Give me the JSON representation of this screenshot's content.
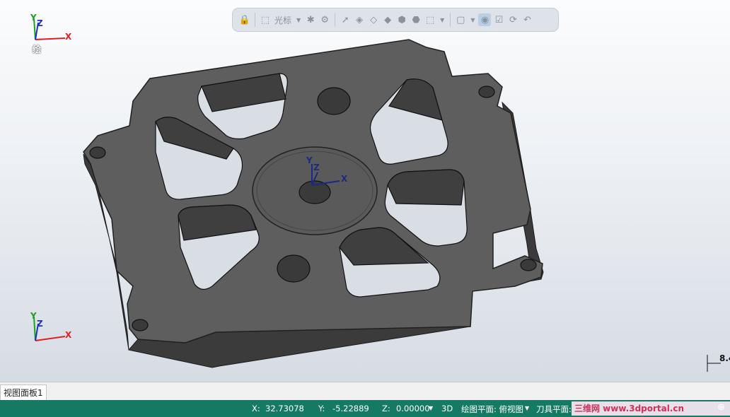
{
  "toolbar": {
    "cursor_label": "光标",
    "icons": [
      "lock-icon",
      "select-cursor-icon",
      "gear-icon",
      "arrow-icon",
      "cube-shaded-icon",
      "cube-wire-icon",
      "cube-solid-icon",
      "cube-blue-icon",
      "cube-iso-icon",
      "select-box-icon",
      "box-select-icon",
      "view-icon",
      "rotate-icon",
      "refresh-icon",
      "undo-icon"
    ]
  },
  "triad_top": {
    "y_label": "Y",
    "z_label": "Z",
    "x_label": "X",
    "caption": "绘"
  },
  "triad_bottom": {
    "y_label": "Y",
    "z_label": "Z",
    "x_label": "X"
  },
  "triad_center": {
    "y_label": "Y",
    "z_label": "Z",
    "x_label": "X"
  },
  "scale": {
    "value": "8.4"
  },
  "tabs": [
    {
      "label": "视图面板1"
    }
  ],
  "status": {
    "x_label": "X:",
    "x_value": "32.73078",
    "y_label": "Y:",
    "y_value": "-5.22889",
    "z_label": "Z:",
    "z_value": "0.00000",
    "mode": "3D",
    "plane_label": "绘图平面: 俯视图",
    "tool_plane_label": "刀具平面: 俯",
    "watermark": "三维网 www.3dportal.cn"
  },
  "colors": {
    "status_bg": "#157a63",
    "part": "#5d5d5d",
    "axis_x": "#e02020",
    "axis_y": "#20a020",
    "axis_z": "#2030c0"
  }
}
